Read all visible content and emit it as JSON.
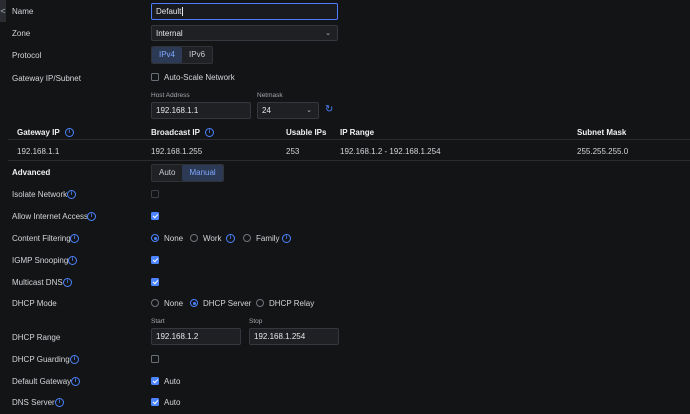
{
  "fields": {
    "name": {
      "label": "Name",
      "value": "Default"
    },
    "zone": {
      "label": "Zone",
      "value": "Internal"
    },
    "protocol": {
      "label": "Protocol",
      "options": [
        "IPv4",
        "IPv6"
      ],
      "selected": "IPv4"
    },
    "gateway_subnet": {
      "label": "Gateway IP/Subnet",
      "auto_scale_label": "Auto-Scale Network",
      "host_address_label": "Host Address",
      "host_address_value": "192.168.1.1",
      "netmask_label": "Netmask",
      "netmask_value": "24"
    }
  },
  "table": {
    "headers": [
      "Gateway IP",
      "Broadcast IP",
      "Usable IPs",
      "IP Range",
      "Subnet Mask"
    ],
    "row": [
      "192.168.1.1",
      "192.168.1.255",
      "253",
      "192.168.1.2 - 192.168.1.254",
      "255.255.255.0"
    ]
  },
  "advanced": {
    "label": "Advanced",
    "options": [
      "Auto",
      "Manual"
    ],
    "selected": "Manual"
  },
  "settings": {
    "isolate_network": "Isolate Network",
    "allow_internet": "Allow Internet Access",
    "content_filtering": {
      "label": "Content Filtering",
      "options": [
        "None",
        "Work",
        "Family"
      ],
      "selected": "None"
    },
    "igmp_snooping": "IGMP Snooping",
    "multicast_dns": "Multicast DNS",
    "dhcp_mode": {
      "label": "DHCP Mode",
      "options": [
        "None",
        "DHCP Server",
        "DHCP Relay"
      ],
      "selected": "DHCP Server"
    },
    "dhcp_range": {
      "label": "DHCP Range",
      "start_label": "Start",
      "start_value": "192.168.1.2",
      "stop_label": "Stop",
      "stop_value": "192.168.1.254"
    },
    "dhcp_guarding": "DHCP Guarding",
    "default_gateway": {
      "label": "Default Gateway",
      "check_label": "Auto"
    },
    "dns_server": {
      "label": "DNS Server",
      "check_label": "Auto"
    }
  },
  "icons": {
    "info": "i",
    "back": "<",
    "chevron": "⌄",
    "refresh": "↻"
  },
  "colors": {
    "accent": "#4c84ff",
    "background": "#131416"
  }
}
